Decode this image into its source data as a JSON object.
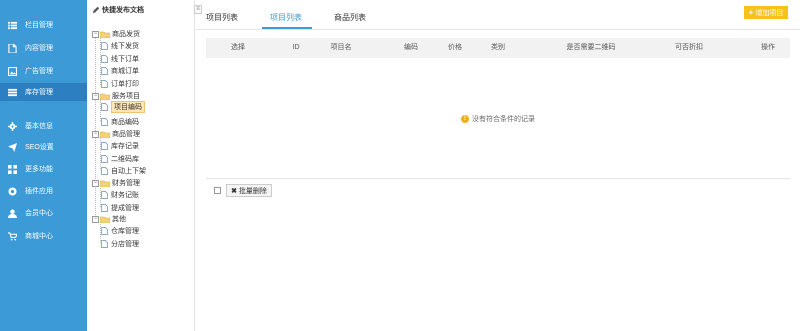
{
  "nav": {
    "items": [
      {
        "label": "栏目管理",
        "icon": "list-icon"
      },
      {
        "label": "内容管理",
        "icon": "document-icon"
      },
      {
        "label": "广告管理",
        "icon": "image-icon"
      },
      {
        "label": "库存管理",
        "icon": "inventory-icon"
      },
      {
        "label": "基本信息",
        "icon": "gear-icon"
      },
      {
        "label": "SEO设置",
        "icon": "send-icon"
      },
      {
        "label": "更多功能",
        "icon": "grid-icon"
      },
      {
        "label": "插件应用",
        "icon": "plugin-icon"
      },
      {
        "label": "会员中心",
        "icon": "user-icon"
      },
      {
        "label": "商城中心",
        "icon": "cart-icon"
      }
    ],
    "active_index": 3
  },
  "tree": {
    "title": "快捷发布文档",
    "toggle_label": "≡",
    "nodes": [
      {
        "label": "商品发货",
        "type": "folder"
      },
      {
        "label": "线下发货",
        "type": "file"
      },
      {
        "label": "线下订单",
        "type": "file"
      },
      {
        "label": "商城订单",
        "type": "file"
      },
      {
        "label": "订单打印",
        "type": "file"
      },
      {
        "label": "服务项目",
        "type": "folder"
      },
      {
        "label": "项目编码",
        "type": "file",
        "selected": true
      },
      {
        "label": "商品编码",
        "type": "file"
      },
      {
        "label": "商品管理",
        "type": "folder"
      },
      {
        "label": "库存记录",
        "type": "file"
      },
      {
        "label": "二维码库",
        "type": "file"
      },
      {
        "label": "自动上下架",
        "type": "file"
      },
      {
        "label": "财务管理",
        "type": "folder"
      },
      {
        "label": "财务记账",
        "type": "file"
      },
      {
        "label": "提成管理",
        "type": "file"
      },
      {
        "label": "其他",
        "type": "folder"
      },
      {
        "label": "仓库管理",
        "type": "file"
      },
      {
        "label": "分店管理",
        "type": "file"
      }
    ]
  },
  "main": {
    "breadcrumb": "项目列表",
    "tabs": [
      {
        "label": "项目列表",
        "active": true
      },
      {
        "label": "商品列表",
        "active": false
      }
    ],
    "add_button": "增加项目",
    "columns": [
      "选择",
      "ID",
      "项目名",
      "编码",
      "价格",
      "类别",
      "是否需要二维码",
      "可否折扣",
      "操作"
    ],
    "empty_message": "没有符合条件的记录",
    "batch_delete": "批量删除"
  },
  "colors": {
    "sidebar": "#3c9ad6",
    "sidebar_active": "#2c7fc0",
    "accent": "#3c9ad6",
    "add_button": "#f7c21a",
    "warning": "#f0ad1e"
  }
}
